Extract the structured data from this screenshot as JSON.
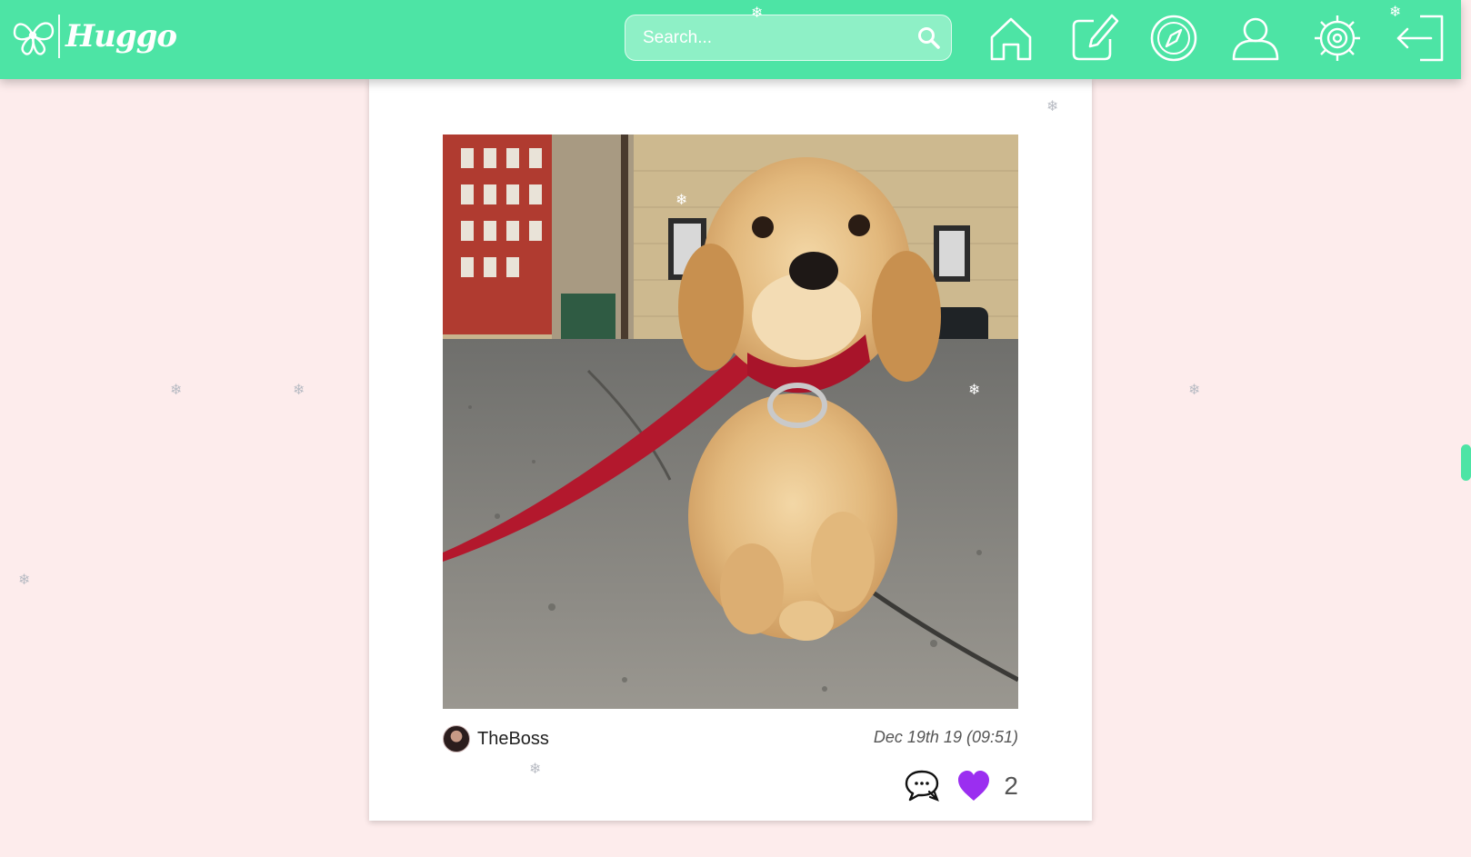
{
  "app": {
    "logo_text": "Huggo"
  },
  "search": {
    "placeholder": "Search..."
  },
  "nav": {
    "icons": [
      "home-icon",
      "edit-icon",
      "compass-icon",
      "profile-icon",
      "settings-icon",
      "logout-icon"
    ]
  },
  "post": {
    "author": "TheBoss",
    "timestamp": "Dec 19th 19 (09:51)",
    "likes": "2"
  },
  "colors": {
    "accent": "#4de4a5",
    "background": "#fdecec",
    "heart": "#9b2ef0"
  },
  "decorations": {
    "snowflake": "❄"
  }
}
